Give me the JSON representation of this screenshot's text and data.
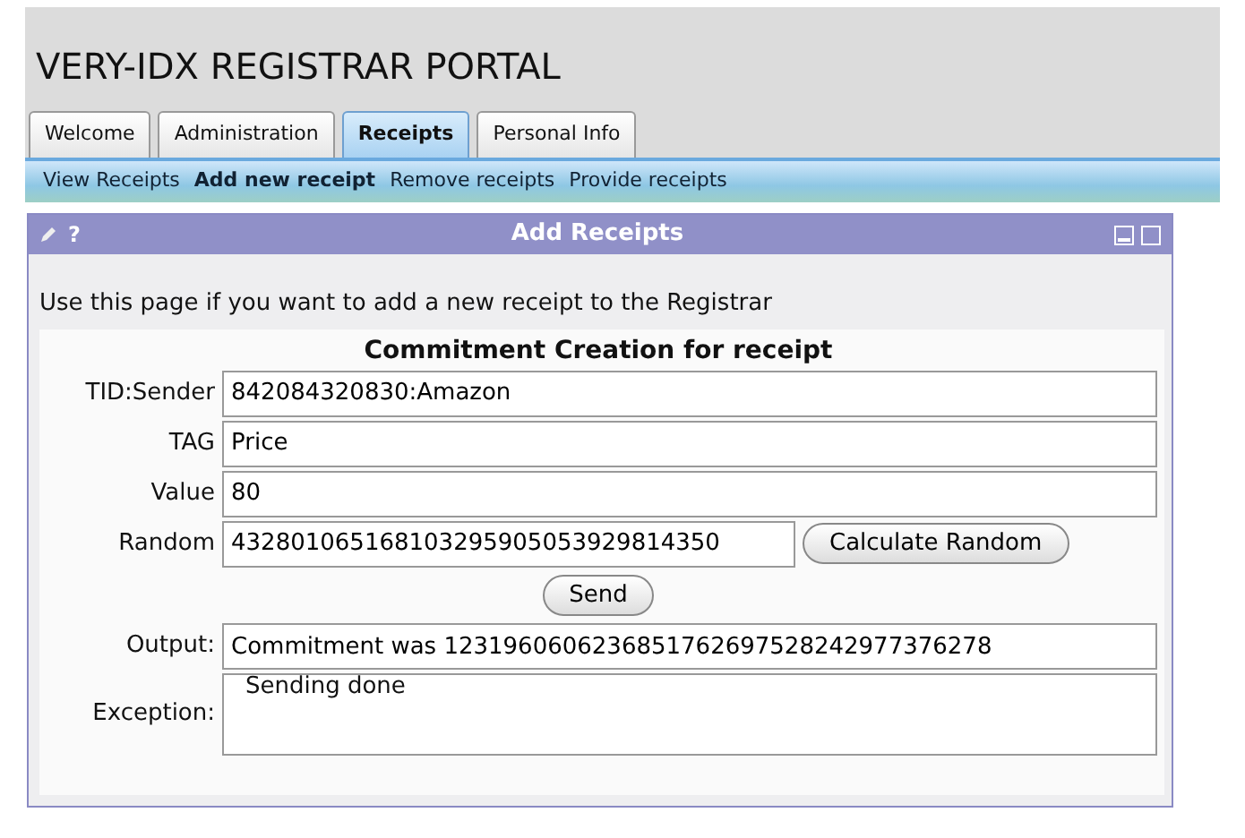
{
  "header": {
    "title": "VERY-IDX REGISTRAR PORTAL"
  },
  "tabs": [
    {
      "label": "Welcome",
      "selected": false
    },
    {
      "label": "Administration",
      "selected": false
    },
    {
      "label": "Receipts",
      "selected": true
    },
    {
      "label": "Personal Info",
      "selected": false
    }
  ],
  "subnav": [
    {
      "label": "View Receipts",
      "selected": false
    },
    {
      "label": "Add new receipt",
      "selected": true
    },
    {
      "label": "Remove receipts",
      "selected": false
    },
    {
      "label": "Provide receipts",
      "selected": false
    }
  ],
  "panel": {
    "title": "Add Receipts",
    "help": "?",
    "intro": "Use this page if you want to add a new receipt to the Registrar",
    "form_title": "Commitment Creation for receipt",
    "fields": [
      {
        "label": "TID:Sender",
        "value": "842084320830:Amazon"
      },
      {
        "label": "TAG",
        "value": "Price"
      },
      {
        "label": "Value",
        "value": "80"
      }
    ],
    "random": {
      "label": "Random",
      "value": "432801065168103295905053929814350",
      "button": "Calculate Random"
    },
    "send_button": "Send",
    "output": {
      "label": "Output:",
      "value": "Commitment was 1231960606236851762697528242977376278"
    },
    "exception": {
      "label": "Exception:",
      "value": "Sending done"
    }
  }
}
